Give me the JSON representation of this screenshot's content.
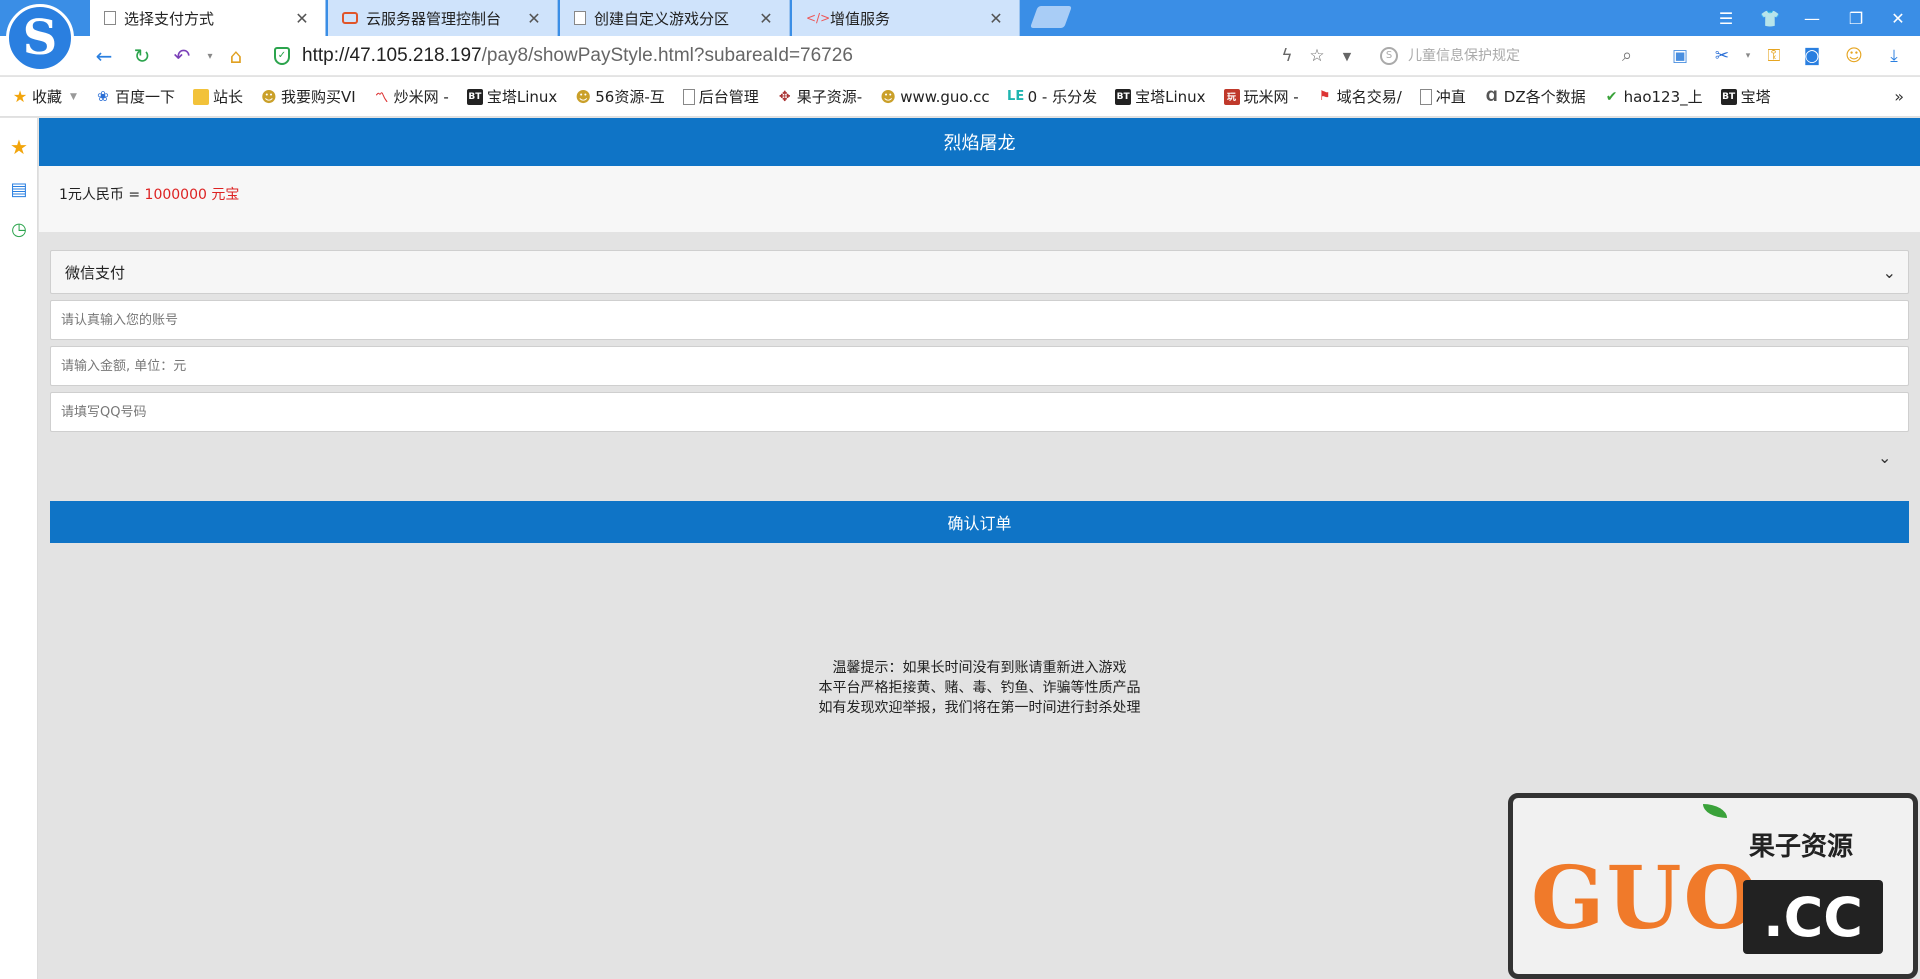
{
  "browser": {
    "tabs": [
      {
        "title": "选择支付方式",
        "active": true
      },
      {
        "title": "云服务器管理控制台",
        "active": false
      },
      {
        "title": "创建自定义游戏分区",
        "active": false
      },
      {
        "title": "增值服务",
        "active": false
      }
    ],
    "url_host": "http://47.105.218.197",
    "url_path": "/pay8/showPayStyle.html?subareaId=76726",
    "search_placeholder": "儿童信息保护规定",
    "bookmarks": [
      {
        "label": "收藏",
        "icon": "star-icon"
      },
      {
        "label": "百度一下",
        "icon": "baidu-paw-icon"
      },
      {
        "label": "站长",
        "icon": "folder-icon"
      },
      {
        "label": "我要购买VI",
        "icon": "smile-icon"
      },
      {
        "label": "炒米网 -",
        "icon": "chart-icon"
      },
      {
        "label": "宝塔Linux",
        "icon": "bt-icon"
      },
      {
        "label": "56资源-互",
        "icon": "smile-icon"
      },
      {
        "label": "后台管理",
        "icon": "doc-icon"
      },
      {
        "label": "果子资源-",
        "icon": "cross-icon"
      },
      {
        "label": "www.guo.cc",
        "icon": "smile-icon"
      },
      {
        "label": "0 - 乐分发",
        "icon": "le-icon"
      },
      {
        "label": "宝塔Linux",
        "icon": "bt-icon"
      },
      {
        "label": "玩米网 -",
        "icon": "wan-icon"
      },
      {
        "label": "域名交易/",
        "icon": "flag-icon"
      },
      {
        "label": "冲直",
        "icon": "doc-icon"
      },
      {
        "label": "DZ各个数据",
        "icon": "dz-icon"
      },
      {
        "label": "hao123_上",
        "icon": "hao-icon"
      },
      {
        "label": "宝塔",
        "icon": "bt-icon"
      }
    ]
  },
  "page": {
    "title": "烈焰屠龙",
    "rate_prefix": "1元人民币 = ",
    "rate_value": "1000000 元宝",
    "pay_method": "微信支付",
    "account_placeholder": "请认真输入您的账号",
    "amount_placeholder": "请输入金额, 单位：元",
    "qq_placeholder": "请填写QQ号码",
    "confirm_label": "确认订单",
    "notice": [
      "温馨提示：如果长时间没有到账请重新进入游戏",
      "本平台严格拒接黄、赌、毒、钓鱼、诈骗等性质产品",
      "如有发现欢迎举报，我们将在第一时间进行封杀处理"
    ]
  },
  "watermark": {
    "brand": "GUO",
    "cn": "果子资源",
    "domain": ".CC"
  },
  "colors": {
    "primary": "#0f74c6",
    "rate_value": "#d22222",
    "tabbar": "#3a8ee6"
  }
}
